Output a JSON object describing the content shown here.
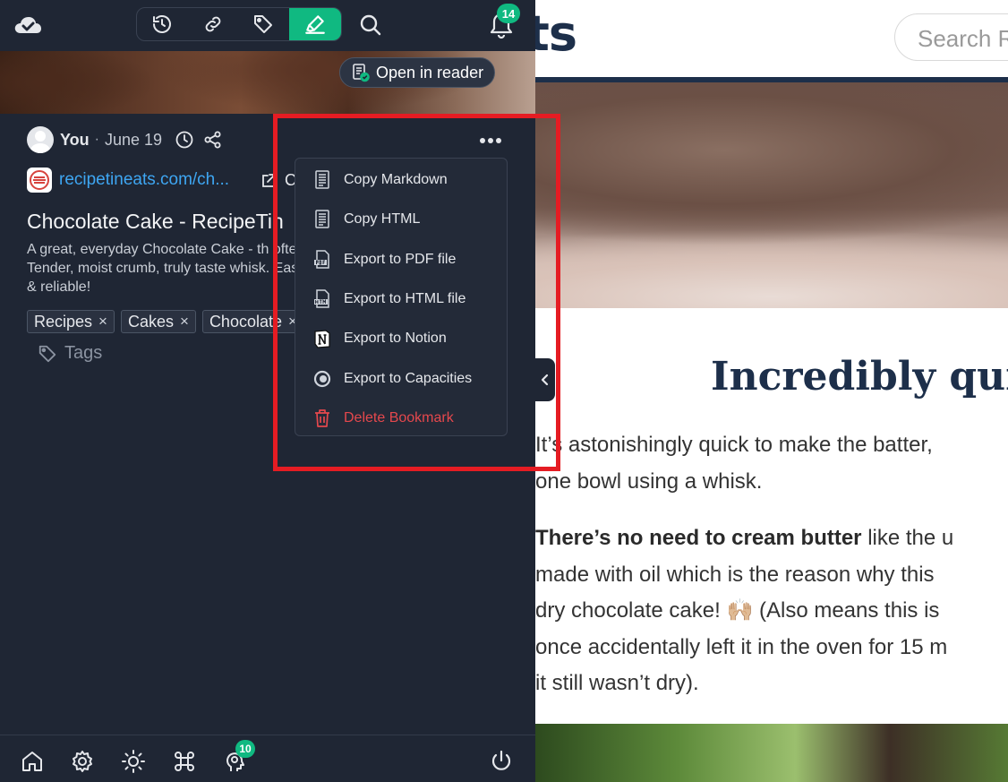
{
  "webpage": {
    "logo_fragment": "ts",
    "search_placeholder": "Search R",
    "heading": "Incredibly quic",
    "para1_line1": "It’s astonishingly quick to make the batter,",
    "para1_line2": "one bowl using a whisk.",
    "para2_bold": "There’s no need to cream butter",
    "para2_line1_rest": " like the u",
    "para2_line2": "made with oil which is the reason why this",
    "para2_line3": "dry chocolate cake! 🙌🏼 (Also means this is",
    "para2_line4": "once accidentally left it in the oven for 15 m",
    "para2_line5": "it still wasn’t dry)."
  },
  "topbar": {
    "notification_count": "14",
    "tabs": [
      {
        "name": "history-icon"
      },
      {
        "name": "link-icon"
      },
      {
        "name": "tag-icon"
      },
      {
        "name": "highlighter-icon",
        "active": true
      }
    ]
  },
  "bookmark": {
    "open_reader_label": "Open in reader",
    "author": "You",
    "separator": "·",
    "date": "June 19",
    "source": "recipetineats.com/ch...",
    "ext_label_fragment": "C",
    "title": "Chocolate Cake - RecipeTin",
    "description": "A great, everyday Chocolate Cake - th often. Tender, moist crumb, truly taste whisk. Easy & reliable!",
    "tags": [
      {
        "label": "Recipes",
        "remove": "×"
      },
      {
        "label": "Cakes",
        "remove": "×"
      },
      {
        "label": "Chocolate",
        "remove": "×"
      }
    ],
    "tags_placeholder": "Tags"
  },
  "menu": {
    "items": [
      {
        "label": "Copy Markdown",
        "icon": "document-icon"
      },
      {
        "label": "Copy HTML",
        "icon": "document-icon"
      },
      {
        "label": "Export to PDF file",
        "icon": "pdf-file-icon"
      },
      {
        "label": "Export to HTML file",
        "icon": "html-file-icon"
      },
      {
        "label": "Export to Notion",
        "icon": "notion-icon"
      },
      {
        "label": "Export to Capacities",
        "icon": "capacities-icon"
      },
      {
        "label": "Delete Bookmark",
        "icon": "trash-icon",
        "color": "#e5484d"
      }
    ]
  },
  "bottombar": {
    "hint_count": "10"
  },
  "colors": {
    "sidebar_bg": "#1f2634",
    "accent": "#10b981",
    "link": "#3ea6f2",
    "danger": "#e5484d",
    "highlight": "#e51c23"
  }
}
